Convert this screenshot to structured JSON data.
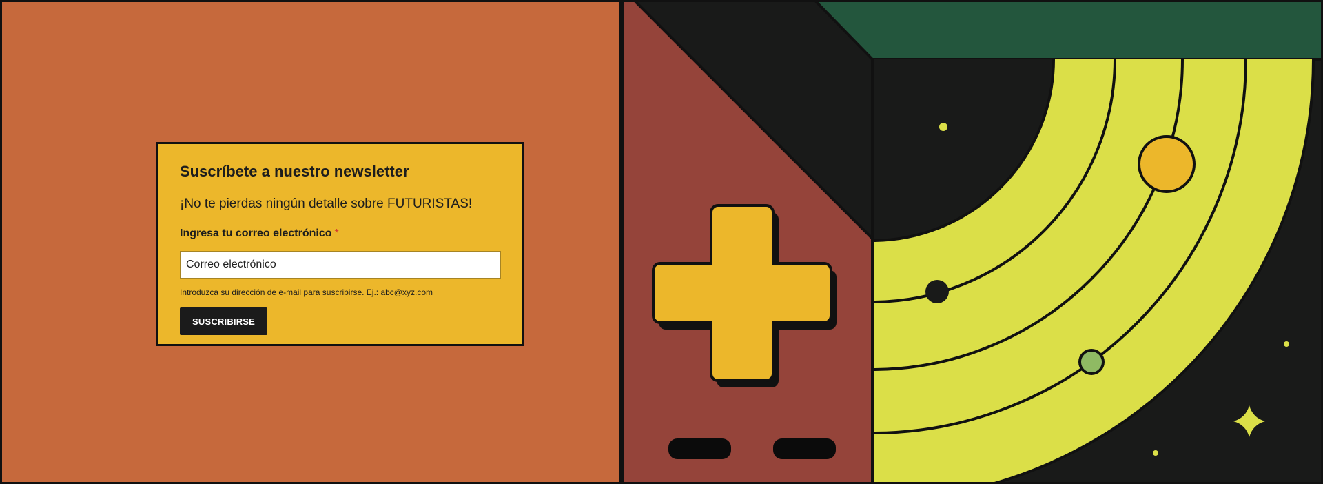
{
  "newsletter": {
    "title": "Suscríbete a nuestro newsletter",
    "subtitle": "¡No te pierdas ningún detalle sobre FUTURISTAS!",
    "email_label": "Ingresa tu correo electrónico",
    "required_mark": "*",
    "email_placeholder": "Correo electrónico",
    "email_value": "",
    "help_text": "Introduzca su dirección de e-mail para suscribirse. Ej.: abc@xyz.com",
    "submit_label": "SUSCRIBIRSE"
  },
  "artwork": {
    "gamepad_icons": [
      "dpad-cross-icon",
      "select-button-icon",
      "start-button-icon"
    ],
    "space_icons": [
      "planet-orbit-icon",
      "sparkle-star-icon",
      "dot-star-icon"
    ]
  },
  "colors": {
    "orange_panel": "#c6693c",
    "form_yellow": "#ecb72b",
    "brick_red": "#95443a",
    "night_black": "#191a19",
    "forest_green": "#23563d",
    "lime_orbit": "#dbdf48",
    "planet_green": "#8fba63",
    "button_dark": "#1b1b1b"
  }
}
